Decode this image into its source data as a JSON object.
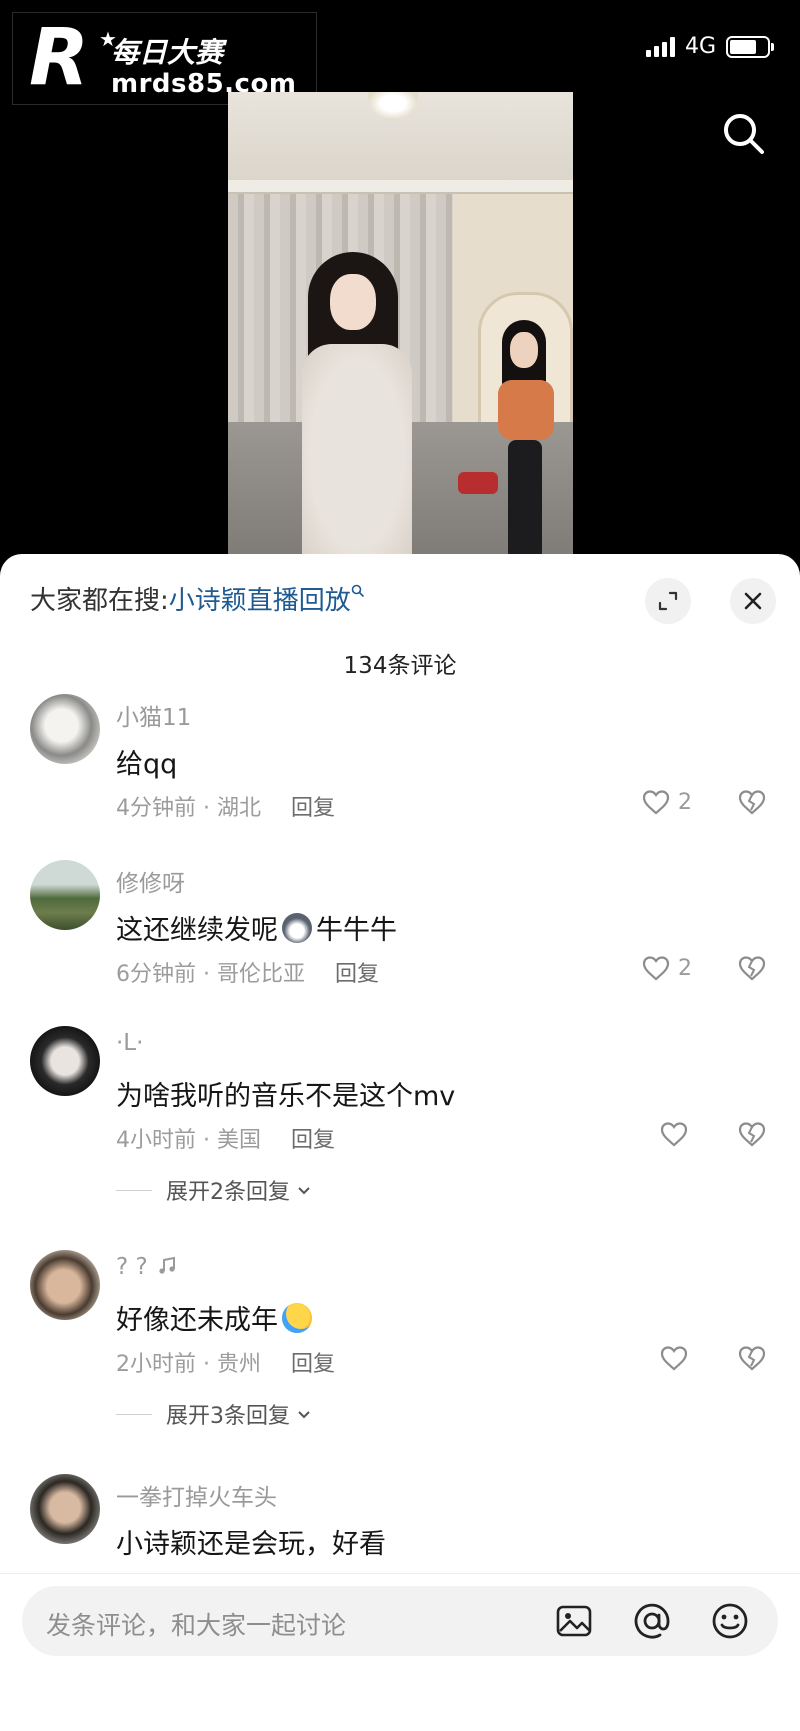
{
  "watermark": {
    "logo_letter": "R",
    "cn_text": "每日大赛",
    "site": "mrds85.com"
  },
  "status_bar": {
    "network": "4G",
    "signal_bars": 4,
    "battery_level": 0.7
  },
  "video": {
    "icon": "search-icon"
  },
  "sheet": {
    "hot_search_prefix": "大家都在搜:",
    "hot_search_keyword": "小诗颖直播回放",
    "comment_count": "134条评论",
    "expand_icon": "expand-icon",
    "close_icon": "close-icon"
  },
  "comments": [
    {
      "username": "小猫11",
      "text": "给qq",
      "time_location": "4分钟前 · 湖北",
      "reply": "回复",
      "likes": "2"
    },
    {
      "username": "修修呀",
      "text_before": "这还继续发呢",
      "text_after": "牛牛牛",
      "time_location": "6分钟前 · 哥伦比亚",
      "reply": "回复",
      "likes": "2"
    },
    {
      "username": "·L·",
      "text": "为啥我听的音乐不是这个mv",
      "time_location": "4小时前 · 美国",
      "reply": "回复",
      "likes": "",
      "expand": "展开2条回复"
    },
    {
      "username": "? ?",
      "text": "好像还未成年",
      "time_location": "2小时前 · 贵州",
      "reply": "回复",
      "likes": "",
      "expand": "展开3条回复"
    },
    {
      "username": "一拳打掉火车头",
      "text": "小诗颖还是会玩，好看"
    }
  ],
  "input_bar": {
    "placeholder": "发条评论，和大家一起讨论",
    "icons": [
      "image-icon",
      "at-icon",
      "emoji-icon"
    ]
  }
}
